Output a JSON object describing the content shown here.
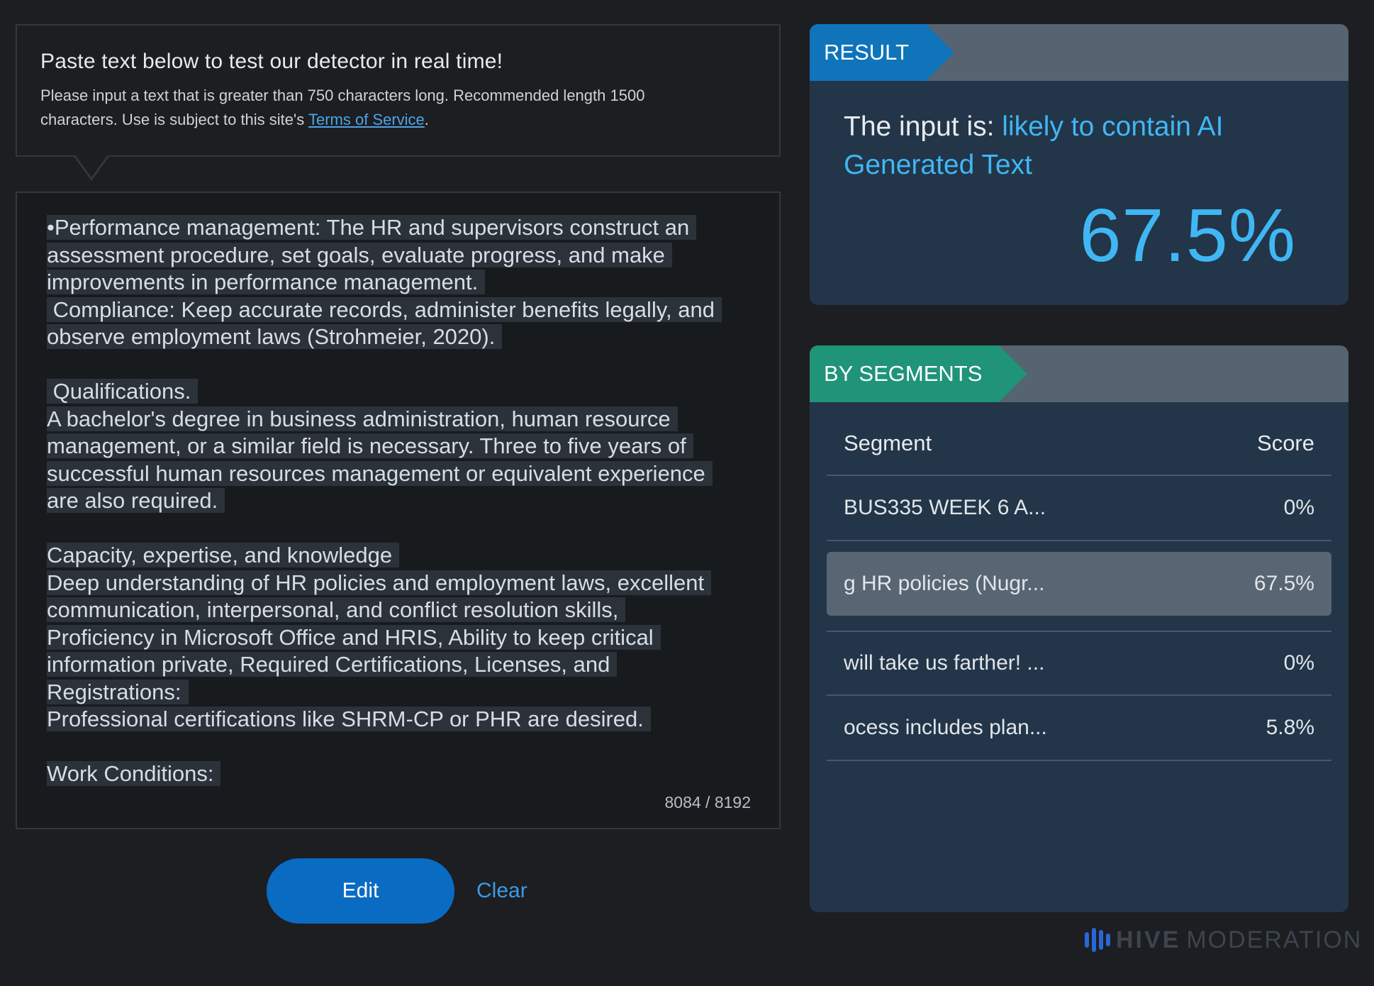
{
  "instructions": {
    "title": "Paste text below to test our detector in real time!",
    "desc_line1": "Please input a text that is greater than 750 characters long. Recommended length 1500",
    "desc_line2_pre": "characters. Use is subject to this site's ",
    "tos_link": "Terms of Service",
    "desc_line2_post": "."
  },
  "editor": {
    "lines": [
      "•Performance management: The HR and supervisors construct an",
      "assessment procedure, set goals, evaluate progress, and make",
      "improvements in performance management.",
      " Compliance: Keep accurate records, administer benefits legally, and",
      "observe employment laws (Strohmeier, 2020).",
      "",
      " Qualifications.",
      "A bachelor's degree in business administration, human resource",
      "management, or a similar field is necessary. Three to five years of",
      "successful human resources management or equivalent experience",
      "are also required.",
      "",
      "Capacity, expertise, and knowledge",
      "Deep understanding of HR policies and employment laws, excellent",
      "communication, interpersonal, and conflict resolution skills,",
      "Proficiency in Microsoft Office and HRIS, Ability to keep critical",
      "information private, Required Certifications, Licenses, and",
      "Registrations:",
      "Professional certifications like SHRM-CP or PHR are desired.",
      "",
      "Work Conditions:"
    ],
    "counter": "8084 / 8192"
  },
  "buttons": {
    "edit": "Edit",
    "clear": "Clear"
  },
  "result": {
    "tag": "RESULT",
    "prefix": "The input is: ",
    "verdict": "likely to contain AI Generated Text",
    "percent": "67.5%"
  },
  "segments": {
    "tag": "BY SEGMENTS",
    "col_segment": "Segment",
    "col_score": "Score",
    "rows": [
      {
        "segment": "BUS335 WEEK 6 A...",
        "score": "0%"
      },
      {
        "segment": "g HR policies (Nugr...",
        "score": "67.5%"
      },
      {
        "segment": "will take us farther! ...",
        "score": "0%"
      },
      {
        "segment": "ocess includes plan...",
        "score": "5.8%"
      }
    ]
  },
  "logo": {
    "brand": "HIVE",
    "product": "MODERATION"
  },
  "colors": {
    "accent": "#3fb7f4",
    "button": "#0a6bc2",
    "result_tag": "#0f74ba",
    "segments_tag": "#1f9478"
  }
}
